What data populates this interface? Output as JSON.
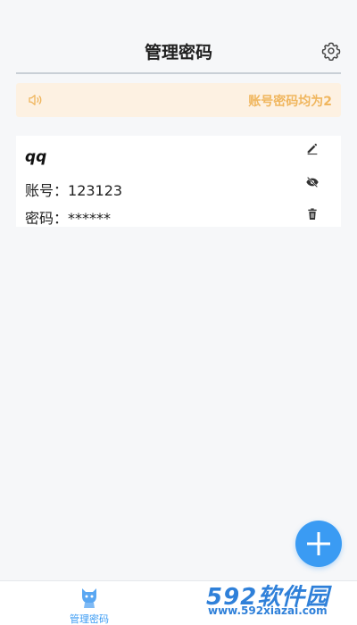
{
  "header": {
    "title": "管理密码",
    "settings_icon": "gear-icon"
  },
  "notice": {
    "icon": "speaker-icon",
    "text": "账号密码均为2"
  },
  "entries": [
    {
      "name": "qq",
      "account_label": "账号：",
      "account": "123123",
      "password_label": "密码：",
      "password": "******",
      "actions": [
        "pencil-icon",
        "eye-off-icon",
        "trash-icon"
      ]
    }
  ],
  "fab": {
    "icon": "plus-icon"
  },
  "tabbar": {
    "tabs": [
      {
        "label": "管理密码",
        "icon": "cat-icon",
        "active": true
      }
    ]
  },
  "watermark": {
    "brand": "592软件园",
    "url": "www.592xiazai.com"
  },
  "colors": {
    "accent": "#3a9bf3",
    "notice_bg": "#fdf1e2",
    "notice_text": "#f0b65e"
  }
}
